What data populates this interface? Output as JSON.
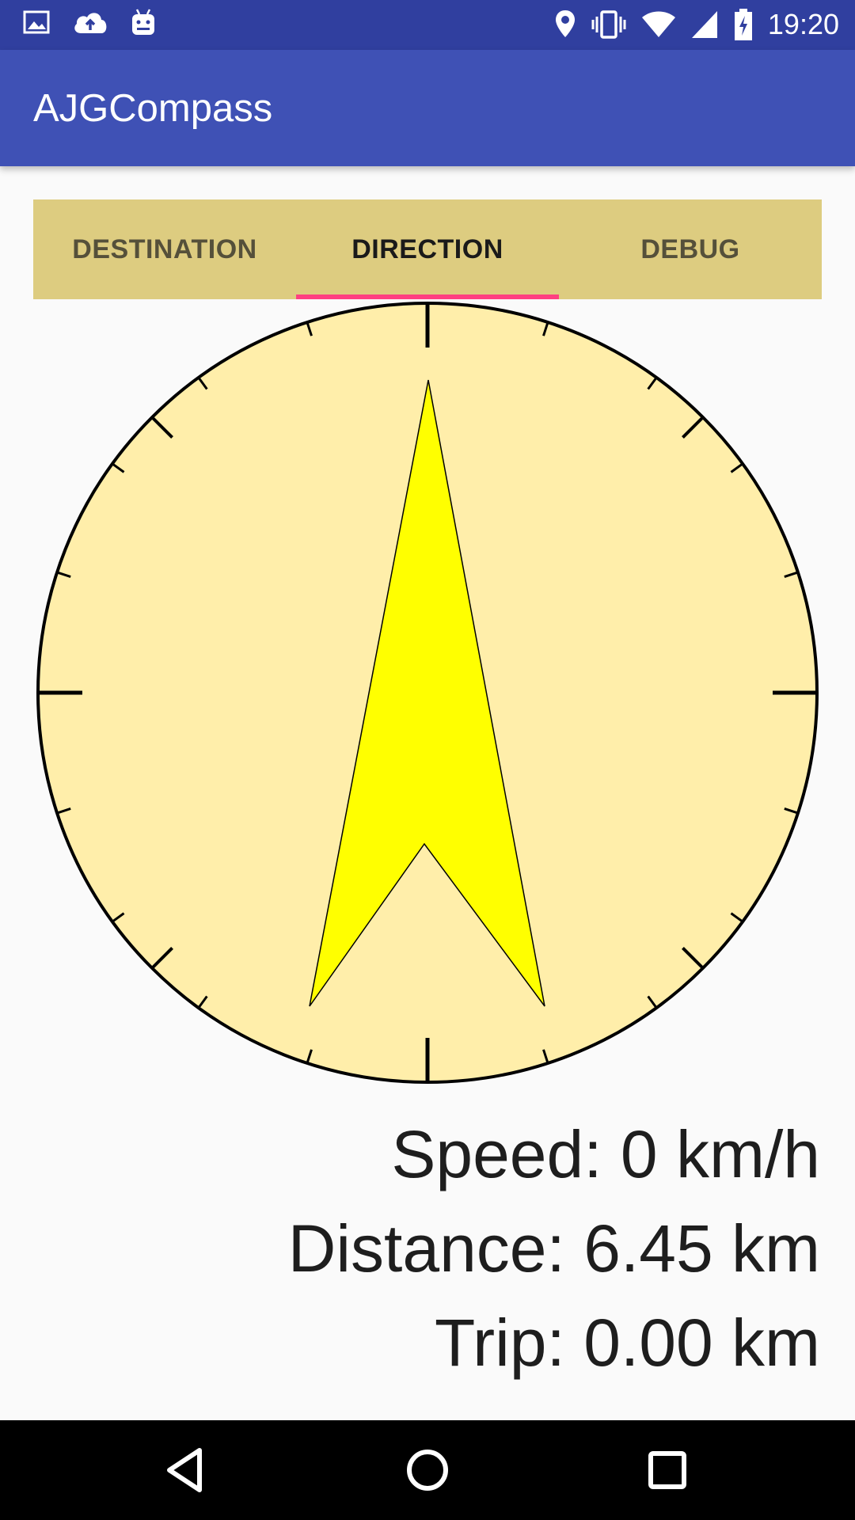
{
  "status_bar": {
    "time": "19:20",
    "left_icons": [
      "image-icon",
      "cloud-upload-icon",
      "android-icon"
    ],
    "right_icons": [
      "location-icon",
      "vibrate-icon",
      "wifi-icon",
      "signal-icon",
      "battery-charging-icon"
    ],
    "background": "#303f9f"
  },
  "app_bar": {
    "title": "AJGCompass",
    "background": "#3f51b5"
  },
  "tabs": {
    "background": "#ddcc80",
    "indicator_color": "#ff4081",
    "items": [
      {
        "label": "DESTINATION",
        "active": false
      },
      {
        "label": "DIRECTION",
        "active": true
      },
      {
        "label": "DEBUG",
        "active": false
      }
    ]
  },
  "compass": {
    "dial_color": "#ffeeaa",
    "needle_color": "#ffff00",
    "needle_heading_deg": 0
  },
  "readouts": {
    "speed": "Speed: 0 km/h",
    "distance": "Distance: 6.45 km",
    "trip": "Trip: 0.00 km"
  },
  "nav_bar": {
    "buttons": [
      "back-icon",
      "home-icon",
      "recents-icon"
    ]
  }
}
